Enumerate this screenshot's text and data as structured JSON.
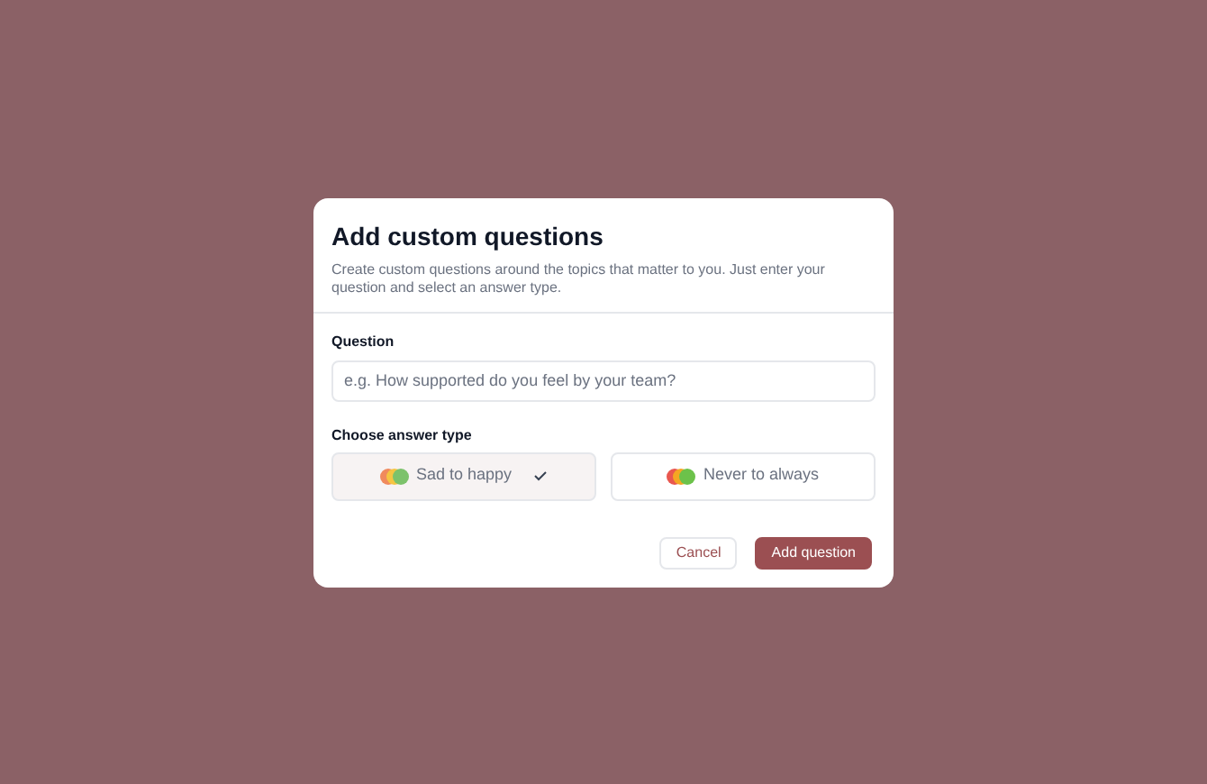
{
  "dialog": {
    "title": "Add custom questions",
    "description": "Create custom questions around the topics that matter to you. Just enter your question and select an answer type.",
    "question": {
      "label": "Question",
      "placeholder": "e.g. How supported do you feel by your team?"
    },
    "answer_type": {
      "label": "Choose answer type",
      "options": [
        {
          "label": "Sad to happy",
          "selected": true,
          "kind": "faces"
        },
        {
          "label": "Never to always",
          "selected": false,
          "kind": "frequency"
        }
      ]
    },
    "buttons": [
      {
        "label": "Cancel",
        "kind": "secondary"
      },
      {
        "label": "Add question",
        "kind": "primary"
      }
    ]
  }
}
